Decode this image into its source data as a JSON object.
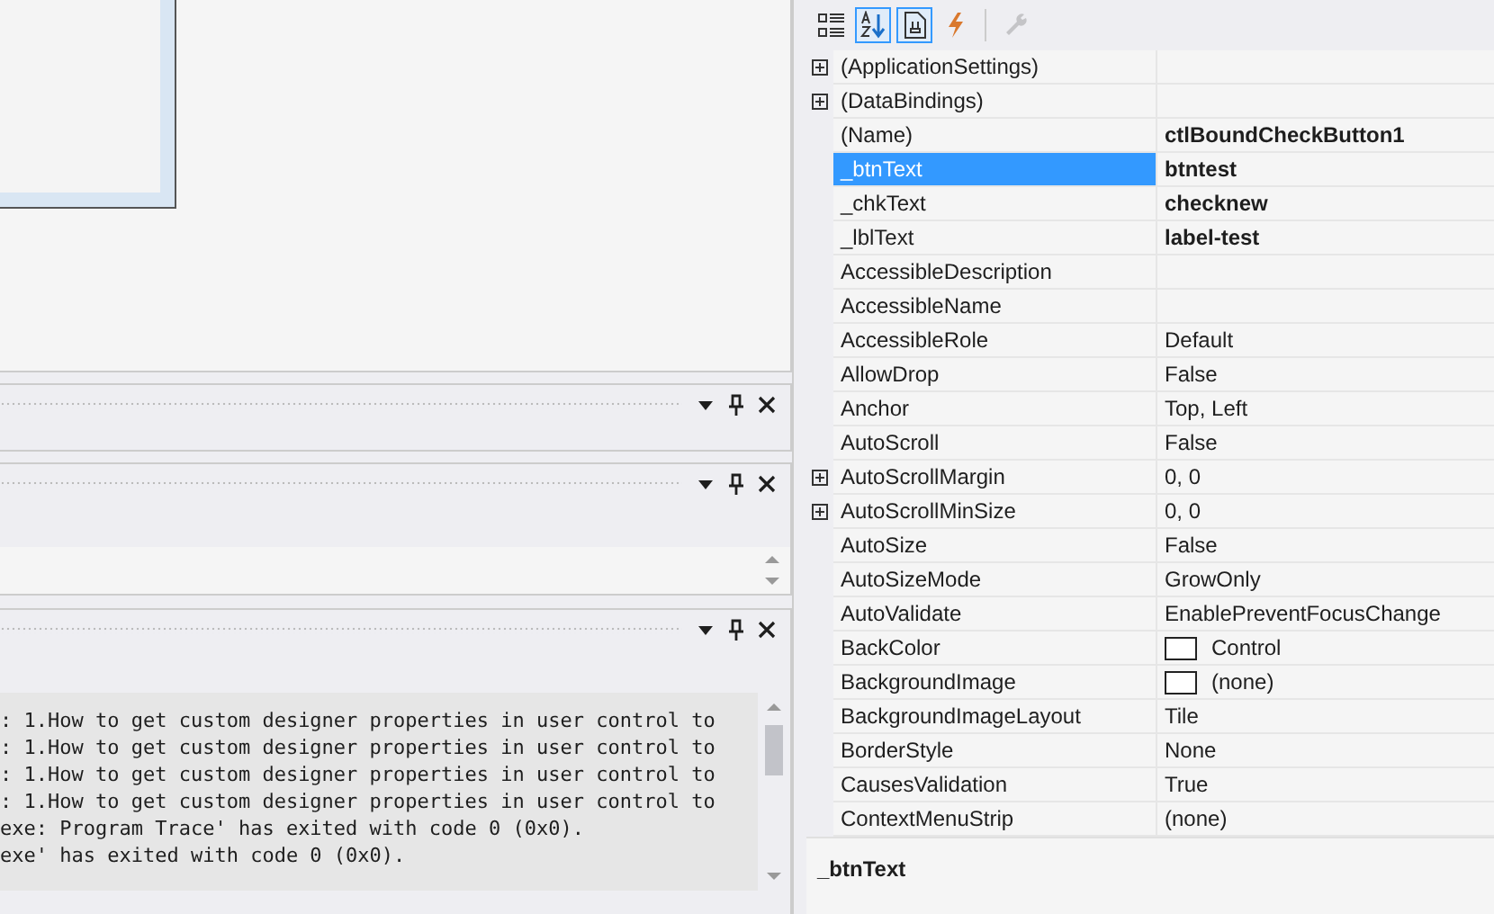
{
  "output": {
    "lines": [
      ": 1.How to get custom designer properties in user control to",
      ": 1.How to get custom designer properties in user control to",
      ": 1.How to get custom designer properties in user control to",
      ": 1.How to get custom designer properties in user control to",
      "exe: Program Trace' has exited with code 0 (0x0).",
      "exe' has exited with code 0 (0x0)."
    ]
  },
  "properties": {
    "toolbar": [
      {
        "kind": "categorized",
        "selected": false,
        "disabled": false
      },
      {
        "kind": "alphabetical",
        "selected": true,
        "disabled": false
      },
      {
        "kind": "properties",
        "selected": true,
        "disabled": false
      },
      {
        "kind": "events",
        "selected": false,
        "disabled": false
      },
      {
        "kind": "pages",
        "selected": false,
        "disabled": true
      }
    ],
    "rows": [
      {
        "name": "(ApplicationSettings)",
        "expandable": true,
        "selected": false,
        "swatch": false
      },
      {
        "name": "(DataBindings)",
        "expandable": true,
        "selected": false,
        "swatch": false
      },
      {
        "name": "(Name)",
        "value": "ctlBoundCheckButton1",
        "expandable": false,
        "modified": true,
        "selected": false,
        "swatch": false
      },
      {
        "name": "_btnText",
        "value": "btntest",
        "expandable": false,
        "modified": true,
        "selected": true,
        "swatch": false
      },
      {
        "name": "_chkText",
        "value": "checknew",
        "expandable": false,
        "modified": true,
        "selected": false,
        "swatch": false
      },
      {
        "name": "_lblText",
        "value": "label-test",
        "expandable": false,
        "modified": true,
        "selected": false,
        "swatch": false
      },
      {
        "name": "AccessibleDescription",
        "expandable": false,
        "selected": false,
        "swatch": false
      },
      {
        "name": "AccessibleName",
        "expandable": false,
        "selected": false,
        "swatch": false
      },
      {
        "name": "AccessibleRole",
        "value": "Default",
        "expandable": false,
        "modified": false,
        "selected": false,
        "swatch": false
      },
      {
        "name": "AllowDrop",
        "value": "False",
        "expandable": false,
        "modified": false,
        "selected": false,
        "swatch": false
      },
      {
        "name": "Anchor",
        "value": "Top, Left",
        "expandable": false,
        "modified": false,
        "selected": false,
        "swatch": false
      },
      {
        "name": "AutoScroll",
        "value": "False",
        "expandable": false,
        "modified": false,
        "selected": false,
        "swatch": false
      },
      {
        "name": "AutoScrollMargin",
        "value": "0, 0",
        "expandable": true,
        "modified": false,
        "selected": false,
        "swatch": false
      },
      {
        "name": "AutoScrollMinSize",
        "value": "0, 0",
        "expandable": true,
        "modified": false,
        "selected": false,
        "swatch": false
      },
      {
        "name": "AutoSize",
        "value": "False",
        "expandable": false,
        "modified": false,
        "selected": false,
        "swatch": false
      },
      {
        "name": "AutoSizeMode",
        "value": "GrowOnly",
        "expandable": false,
        "modified": false,
        "selected": false,
        "swatch": false
      },
      {
        "name": "AutoValidate",
        "value": "EnablePreventFocusChange",
        "expandable": false,
        "modified": false,
        "selected": false,
        "swatch": false
      },
      {
        "name": "BackColor",
        "value": "Control",
        "expandable": false,
        "modified": false,
        "selected": false,
        "swatch": true
      },
      {
        "name": "BackgroundImage",
        "value": "(none)",
        "expandable": false,
        "modified": false,
        "selected": false,
        "swatch": true
      },
      {
        "name": "BackgroundImageLayout",
        "value": "Tile",
        "expandable": false,
        "modified": false,
        "selected": false,
        "swatch": false
      },
      {
        "name": "BorderStyle",
        "value": "None",
        "expandable": false,
        "modified": false,
        "selected": false,
        "swatch": false
      },
      {
        "name": "CausesValidation",
        "value": "True",
        "expandable": false,
        "modified": false,
        "selected": false,
        "swatch": false
      },
      {
        "name": "ContextMenuStrip",
        "value": "(none)",
        "expandable": false,
        "modified": false,
        "selected": false,
        "swatch": false
      }
    ],
    "description": {
      "title": "_btnText"
    }
  }
}
